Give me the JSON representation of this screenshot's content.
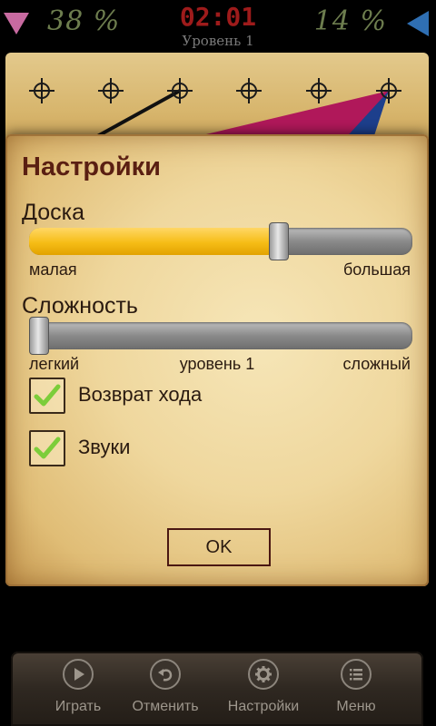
{
  "status": {
    "left_percent": "38 %",
    "timer": "02:01",
    "level": "Уровень 1",
    "right_percent": "14 %"
  },
  "dialog": {
    "title": "Настройки",
    "board": {
      "label": "Доска",
      "value_fraction": 0.66,
      "min_label": "малая",
      "max_label": "большая"
    },
    "difficulty": {
      "label": "Сложность",
      "value_fraction": 0.0,
      "min_label": "легкий",
      "mid_label": "уровень 1",
      "max_label": "сложный"
    },
    "undo": {
      "label": "Возврат хода",
      "checked": true
    },
    "sounds": {
      "label": "Звуки",
      "checked": true
    },
    "ok_label": "OK"
  },
  "toolbar": {
    "items": [
      {
        "label": "Играть",
        "icon": "play-icon"
      },
      {
        "label": "Отменить",
        "icon": "undo-icon"
      },
      {
        "label": "Настройки",
        "icon": "gear-icon"
      },
      {
        "label": "Меню",
        "icon": "list-icon"
      }
    ]
  },
  "colors": {
    "slider_fill": "#f6bd16",
    "title": "#5a1f12",
    "timer": "#9e1b1b",
    "player_left": "#c86aa0",
    "player_right": "#2f6fb3"
  }
}
